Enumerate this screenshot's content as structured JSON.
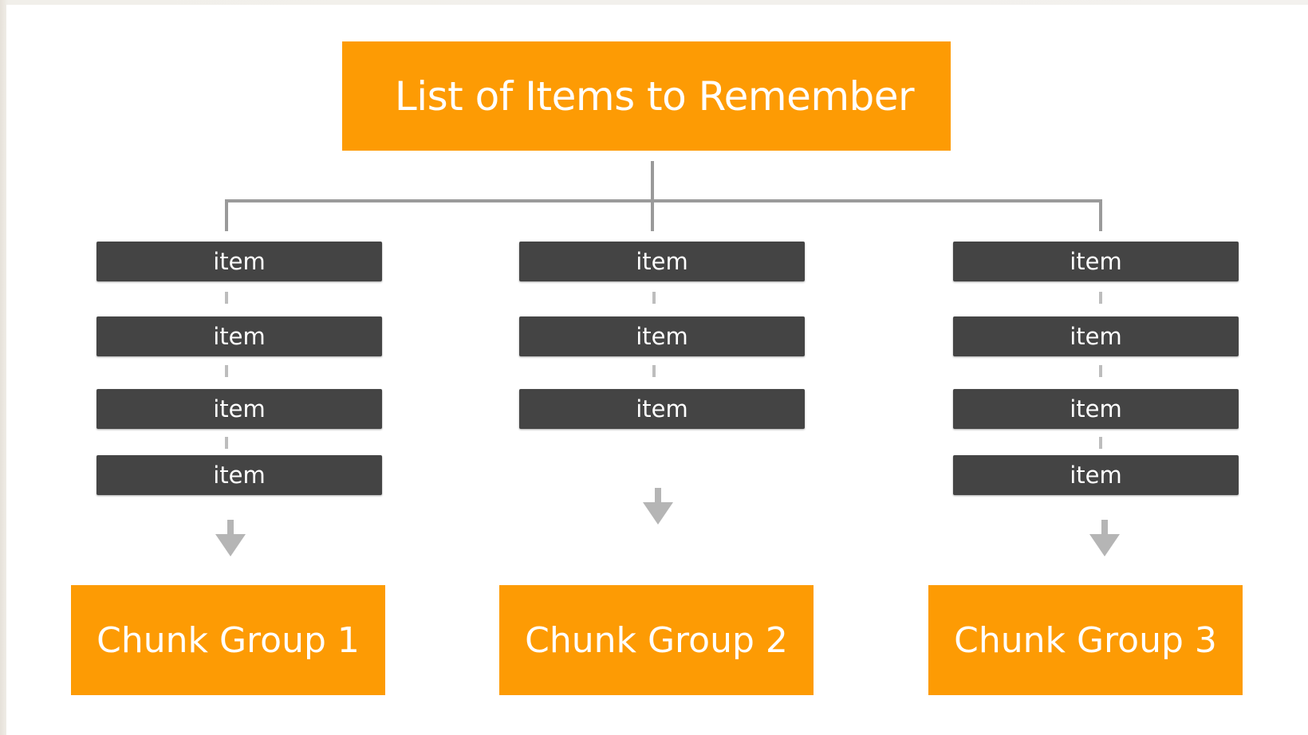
{
  "diagram": {
    "title": "List of Items to Remember",
    "columns": [
      {
        "items": [
          "item",
          "item",
          "item",
          "item"
        ],
        "group_label": "Chunk Group 1"
      },
      {
        "items": [
          "item",
          "item",
          "item"
        ],
        "group_label": "Chunk Group 2"
      },
      {
        "items": [
          "item",
          "item",
          "item",
          "item"
        ],
        "group_label": "Chunk Group 3"
      }
    ]
  },
  "colors": {
    "accent_orange": "#fd9b04",
    "item_dark": "#444444",
    "connector_gray": "#9a9a9a",
    "arrow_gray": "#b5b5b5"
  }
}
